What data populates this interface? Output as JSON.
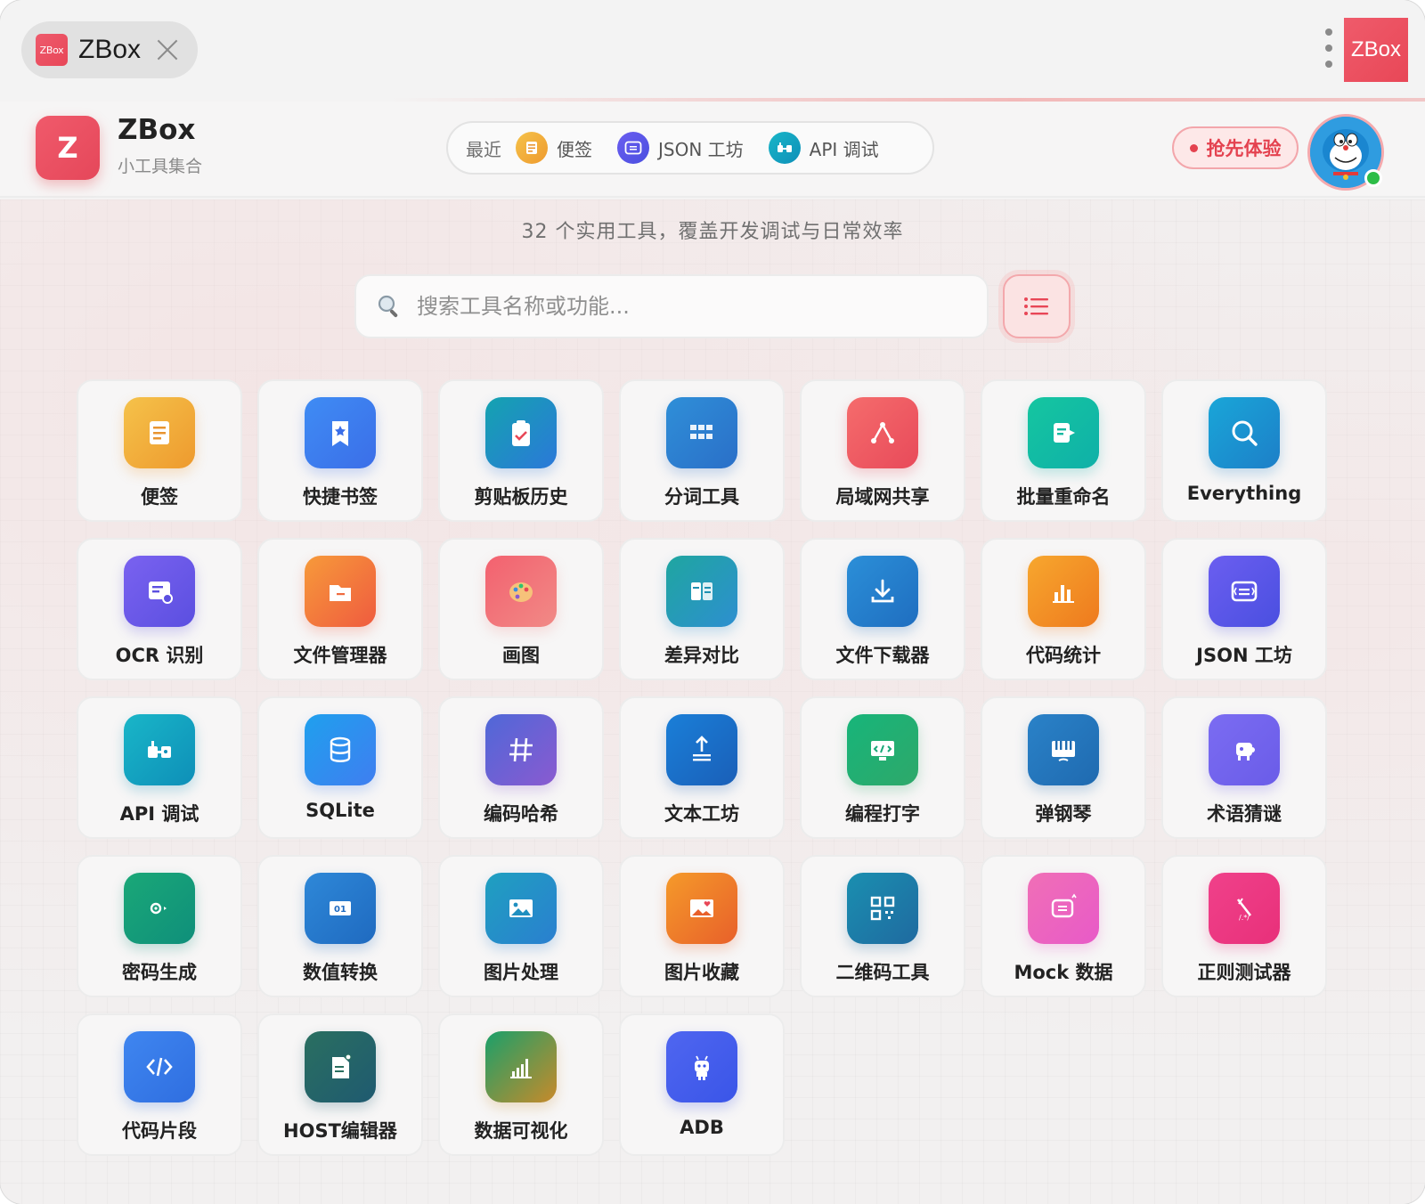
{
  "tab": {
    "favicon_text": "ZBox",
    "title": "ZBox"
  },
  "corner_badge": "ZBox",
  "header": {
    "logo_letter": "Z",
    "title": "ZBox",
    "subtitle": "小工具集合",
    "recent_label": "最近",
    "recent": [
      {
        "label": "便签",
        "icon": "note-icon",
        "color": "#f0a830"
      },
      {
        "label": "JSON 工坊",
        "icon": "json-icon",
        "color": "#5b5bea"
      },
      {
        "label": "API 调试",
        "icon": "api-icon",
        "color": "#17a6c8"
      }
    ],
    "try_label": "抢先体验"
  },
  "main": {
    "subtitle": "32 个实用工具，覆盖开发调试与日常效率",
    "search_placeholder": "搜索工具名称或功能...",
    "tools": [
      {
        "label": "便签",
        "icon": "note-icon",
        "bg": [
          "#f5c24a",
          "#ee9a2e"
        ]
      },
      {
        "label": "快捷书签",
        "icon": "bookmark-icon",
        "bg": [
          "#3f8cf4",
          "#3b6ee8"
        ]
      },
      {
        "label": "剪贴板历史",
        "icon": "clipboard-icon",
        "bg": [
          "#14a3b0",
          "#2b78d9"
        ]
      },
      {
        "label": "分词工具",
        "icon": "segment-icon",
        "bg": [
          "#2f8fd8",
          "#2a6fc8"
        ]
      },
      {
        "label": "局域网共享",
        "icon": "share-icon",
        "bg": [
          "#f56c6c",
          "#e84a5a"
        ]
      },
      {
        "label": "批量重命名",
        "icon": "rename-icon",
        "bg": [
          "#15c6a0",
          "#0fb0a8"
        ]
      },
      {
        "label": "Everything",
        "icon": "search-icon",
        "bg": [
          "#1aa6d8",
          "#1c7fc8"
        ]
      },
      {
        "label": "OCR 识别",
        "icon": "ocr-icon",
        "bg": [
          "#7a62f0",
          "#5b4fe0"
        ]
      },
      {
        "label": "文件管理器",
        "icon": "folder-icon",
        "bg": [
          "#f79a3a",
          "#ef5b3f"
        ]
      },
      {
        "label": "画图",
        "icon": "palette-icon",
        "bg": [
          "#f3616f",
          "#f18a86"
        ]
      },
      {
        "label": "差异对比",
        "icon": "diff-icon",
        "bg": [
          "#1fa6a0",
          "#2d8fd0"
        ]
      },
      {
        "label": "文件下载器",
        "icon": "download-icon",
        "bg": [
          "#2b8fd8",
          "#1f6ec0"
        ]
      },
      {
        "label": "代码统计",
        "icon": "bar-chart-icon",
        "bg": [
          "#f7a72e",
          "#ee7a1e"
        ]
      },
      {
        "label": "JSON 工坊",
        "icon": "json-icon",
        "bg": [
          "#6b5ef0",
          "#4a4fe0"
        ]
      },
      {
        "label": "API 调试",
        "icon": "api-icon",
        "bg": [
          "#19b6c8",
          "#0e8fb8"
        ]
      },
      {
        "label": "SQLite",
        "icon": "database-icon",
        "bg": [
          "#1fa0ee",
          "#3f7ef0"
        ]
      },
      {
        "label": "编码哈希",
        "icon": "hash-icon",
        "bg": [
          "#4f68d8",
          "#8a5ad0"
        ]
      },
      {
        "label": "文本工坊",
        "icon": "text-upload-icon",
        "bg": [
          "#1a7fd8",
          "#1a5fb8"
        ]
      },
      {
        "label": "编程打字",
        "icon": "code-monitor-icon",
        "bg": [
          "#17b57a",
          "#2ea86a"
        ]
      },
      {
        "label": "弹钢琴",
        "icon": "piano-icon",
        "bg": [
          "#2a82c8",
          "#1f6ab0"
        ]
      },
      {
        "label": "术语猜谜",
        "icon": "puzzle-icon",
        "bg": [
          "#7b6cf2",
          "#6a5ce8"
        ]
      },
      {
        "label": "密码生成",
        "icon": "password-icon",
        "bg": [
          "#1aa878",
          "#0f8f7a"
        ]
      },
      {
        "label": "数值转换",
        "icon": "number-icon",
        "bg": [
          "#2e88d8",
          "#1f6ac0"
        ]
      },
      {
        "label": "图片处理",
        "icon": "image-icon",
        "bg": [
          "#1fa0c0",
          "#2a7fd0"
        ]
      },
      {
        "label": "图片收藏",
        "icon": "image-heart-icon",
        "bg": [
          "#f59a2a",
          "#e8602a"
        ]
      },
      {
        "label": "二维码工具",
        "icon": "qrcode-icon",
        "bg": [
          "#1a8fb0",
          "#1f6aa0"
        ]
      },
      {
        "label": "Mock 数据",
        "icon": "mock-icon",
        "bg": [
          "#f06fb6",
          "#e85ac8"
        ]
      },
      {
        "label": "正则测试器",
        "icon": "regex-icon",
        "bg": [
          "#f0418a",
          "#e8307a"
        ]
      },
      {
        "label": "代码片段",
        "icon": "code-icon",
        "bg": [
          "#3f86f0",
          "#2f6ee0"
        ]
      },
      {
        "label": "HOST编辑器",
        "icon": "host-file-icon",
        "bg": [
          "#2a6f60",
          "#1f5a70"
        ]
      },
      {
        "label": "数据可视化",
        "icon": "data-chart-icon",
        "bg": [
          "#1aa06a",
          "#c88a2a"
        ]
      },
      {
        "label": "ADB",
        "icon": "android-icon",
        "bg": [
          "#4f66f0",
          "#3a55e8"
        ]
      }
    ]
  },
  "colors": {
    "accent": "#e84757",
    "try_bg": "#fde8e8",
    "online": "#2ebd47"
  }
}
